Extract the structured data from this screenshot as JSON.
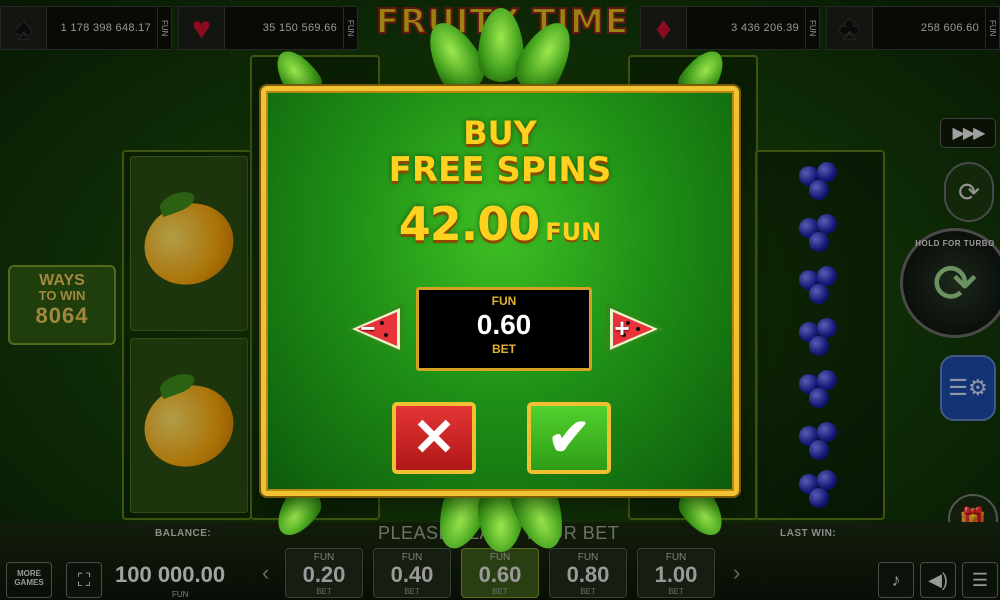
{
  "jackpots": [
    {
      "suit": "spade-icon",
      "glyph": "♠",
      "amount": "1 178 398 648.17",
      "currency": "FUN"
    },
    {
      "suit": "heart-icon",
      "glyph": "♥",
      "amount": "35 150 569.66",
      "currency": "FUN"
    },
    {
      "suit": "diamond-icon",
      "glyph": "♦",
      "amount": "3 436 206.39",
      "currency": "FUN"
    },
    {
      "suit": "club-icon",
      "glyph": "♣",
      "amount": "258 606.60",
      "currency": "FUN"
    }
  ],
  "game_title": "FRUITY TIME",
  "ways_to_win": {
    "line1": "WAYS",
    "line2": "TO WIN",
    "value": "8064"
  },
  "controls": {
    "hold_for_turbo": "HOLD FOR TURBO",
    "fast_forward": "▶▶▶"
  },
  "modal": {
    "title_line1": "BUY",
    "title_line2": "FREE SPINS",
    "price": "42.00",
    "price_currency": "FUN",
    "bet_currency": "FUN",
    "bet_value": "0.60",
    "bet_label": "BET",
    "minus": "−",
    "plus": "+",
    "cancel": "✕",
    "confirm": "✔"
  },
  "bottom": {
    "more_games": "MORE GAMES",
    "balance_label": "BALANCE:",
    "balance_value": "100 000.00",
    "balance_currency": "FUN",
    "place_bet": "PLEASE PLACE YOUR BET",
    "last_win_label": "LAST WIN:",
    "bets": [
      {
        "currency": "FUN",
        "value": "0.20",
        "label": "BET"
      },
      {
        "currency": "FUN",
        "value": "0.40",
        "label": "BET"
      },
      {
        "currency": "FUN",
        "value": "0.60",
        "label": "BET",
        "selected": true
      },
      {
        "currency": "FUN",
        "value": "0.80",
        "label": "BET"
      },
      {
        "currency": "FUN",
        "value": "1.00",
        "label": "BET"
      }
    ]
  },
  "colors": {
    "gold": "#ffd21f",
    "modal_green": "#1f9116",
    "cancel_red": "#d42626",
    "confirm_green": "#43bb24"
  }
}
